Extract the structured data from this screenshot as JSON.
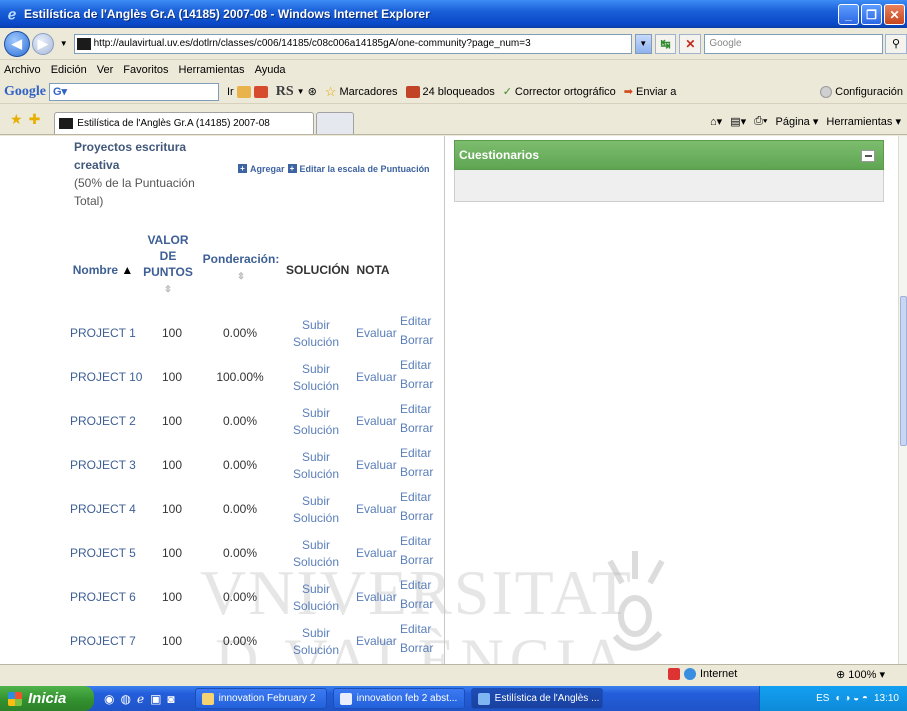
{
  "window": {
    "title": "Estilística de l'Anglès Gr.A (14185) 2007-08 - Windows Internet Explorer"
  },
  "address": {
    "url": "http://aulavirtual.uv.es/dotlrn/classes/c006/14185/c08c006a14185gA/one-community?page_num=3",
    "search_placeholder": "Google"
  },
  "menu": [
    "Archivo",
    "Edición",
    "Ver",
    "Favoritos",
    "Herramientas",
    "Ayuda"
  ],
  "google_toolbar": {
    "logo": "Google",
    "box_value": "G▾",
    "go_label": "Ir",
    "rs_label": "RS",
    "bookmarks": "Marcadores",
    "blocked": "24 bloqueados",
    "spell": "Corrector ortográfico",
    "send": "Enviar a",
    "settings": "Configuración"
  },
  "tab": {
    "label": "Estilística de l'Anglès Gr.A (14185) 2007-08"
  },
  "command_bar": {
    "page": "Página",
    "tools": "Herramientas"
  },
  "section": {
    "title": "Proyectos escritura creativa",
    "subtitle": "(50% de la Puntuación Total)",
    "add_link": "Agregar",
    "edit_scale_link": "Editar la escala de Puntuación"
  },
  "columns": {
    "name": "Nombre",
    "points": "VALOR DE PUNTOS",
    "weight": "Ponderación:",
    "solution": "SOLUCIÓN",
    "grade": "NOTA"
  },
  "rows": [
    {
      "name": "PROJECT 1",
      "points": "100",
      "weight": "0.00%"
    },
    {
      "name": "PROJECT 10",
      "points": "100",
      "weight": "100.00%"
    },
    {
      "name": "PROJECT 2",
      "points": "100",
      "weight": "0.00%"
    },
    {
      "name": "PROJECT 3",
      "points": "100",
      "weight": "0.00%"
    },
    {
      "name": "PROJECT 4",
      "points": "100",
      "weight": "0.00%"
    },
    {
      "name": "PROJECT 5",
      "points": "100",
      "weight": "0.00%"
    },
    {
      "name": "PROJECT 6",
      "points": "100",
      "weight": "0.00%"
    },
    {
      "name": "PROJECT 7",
      "points": "100",
      "weight": "0.00%"
    }
  ],
  "row_actions": {
    "upload_1": "Subir",
    "upload_2": "Solución",
    "evaluate": "Evaluar",
    "edit": "Editar",
    "delete": "Borrar"
  },
  "quiz_panel": {
    "title": "Cuestionarios"
  },
  "watermark": {
    "line1": "VNIVERSITAT",
    "line2": "D VALÈNCIA"
  },
  "status": {
    "zone": "Internet",
    "zoom": "100%"
  },
  "taskbar": {
    "start": "Inicia",
    "tasks": [
      "innovation February 2",
      "innovation feb 2 abst...",
      "Estilística de l'Anglès ..."
    ],
    "lang": "ES",
    "clock": "13:10"
  },
  "colors": {
    "link": "#3d5f95",
    "panel_green": "#5ea552",
    "title_blue": "#1a5fd8"
  }
}
